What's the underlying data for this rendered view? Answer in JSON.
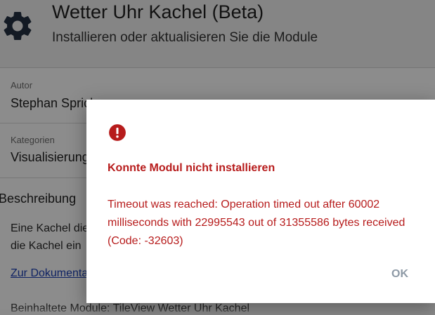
{
  "header": {
    "title": "Wetter Uhr Kachel (Beta)",
    "subtitle": "Installieren oder aktualisieren Sie die Module",
    "icon": "gear-icon"
  },
  "fields": [
    {
      "label": "Autor",
      "value": "Stephan Sprich"
    },
    {
      "label": "Kategorien",
      "value": "Visualisierung"
    }
  ],
  "description": {
    "title": "Beschreibung",
    "lines": [
      "Eine Kachel die",
      "die Kachel ein"
    ],
    "link": "Zur Dokumentation"
  },
  "footer": {
    "text": "Beinhaltete Module: TileView Wetter Uhr Kachel"
  },
  "dialog": {
    "icon": "error-icon",
    "title": "Konnte Modul nicht installieren",
    "message": "Timeout was reached: Operation timed out after 60002 milliseconds with 22995543 out of 31355586 bytes received (Code: -32603)",
    "ok_label": "OK"
  },
  "colors": {
    "error": "#b71c1c",
    "link": "#1a3fb5",
    "ok": "#8e9aa6"
  }
}
